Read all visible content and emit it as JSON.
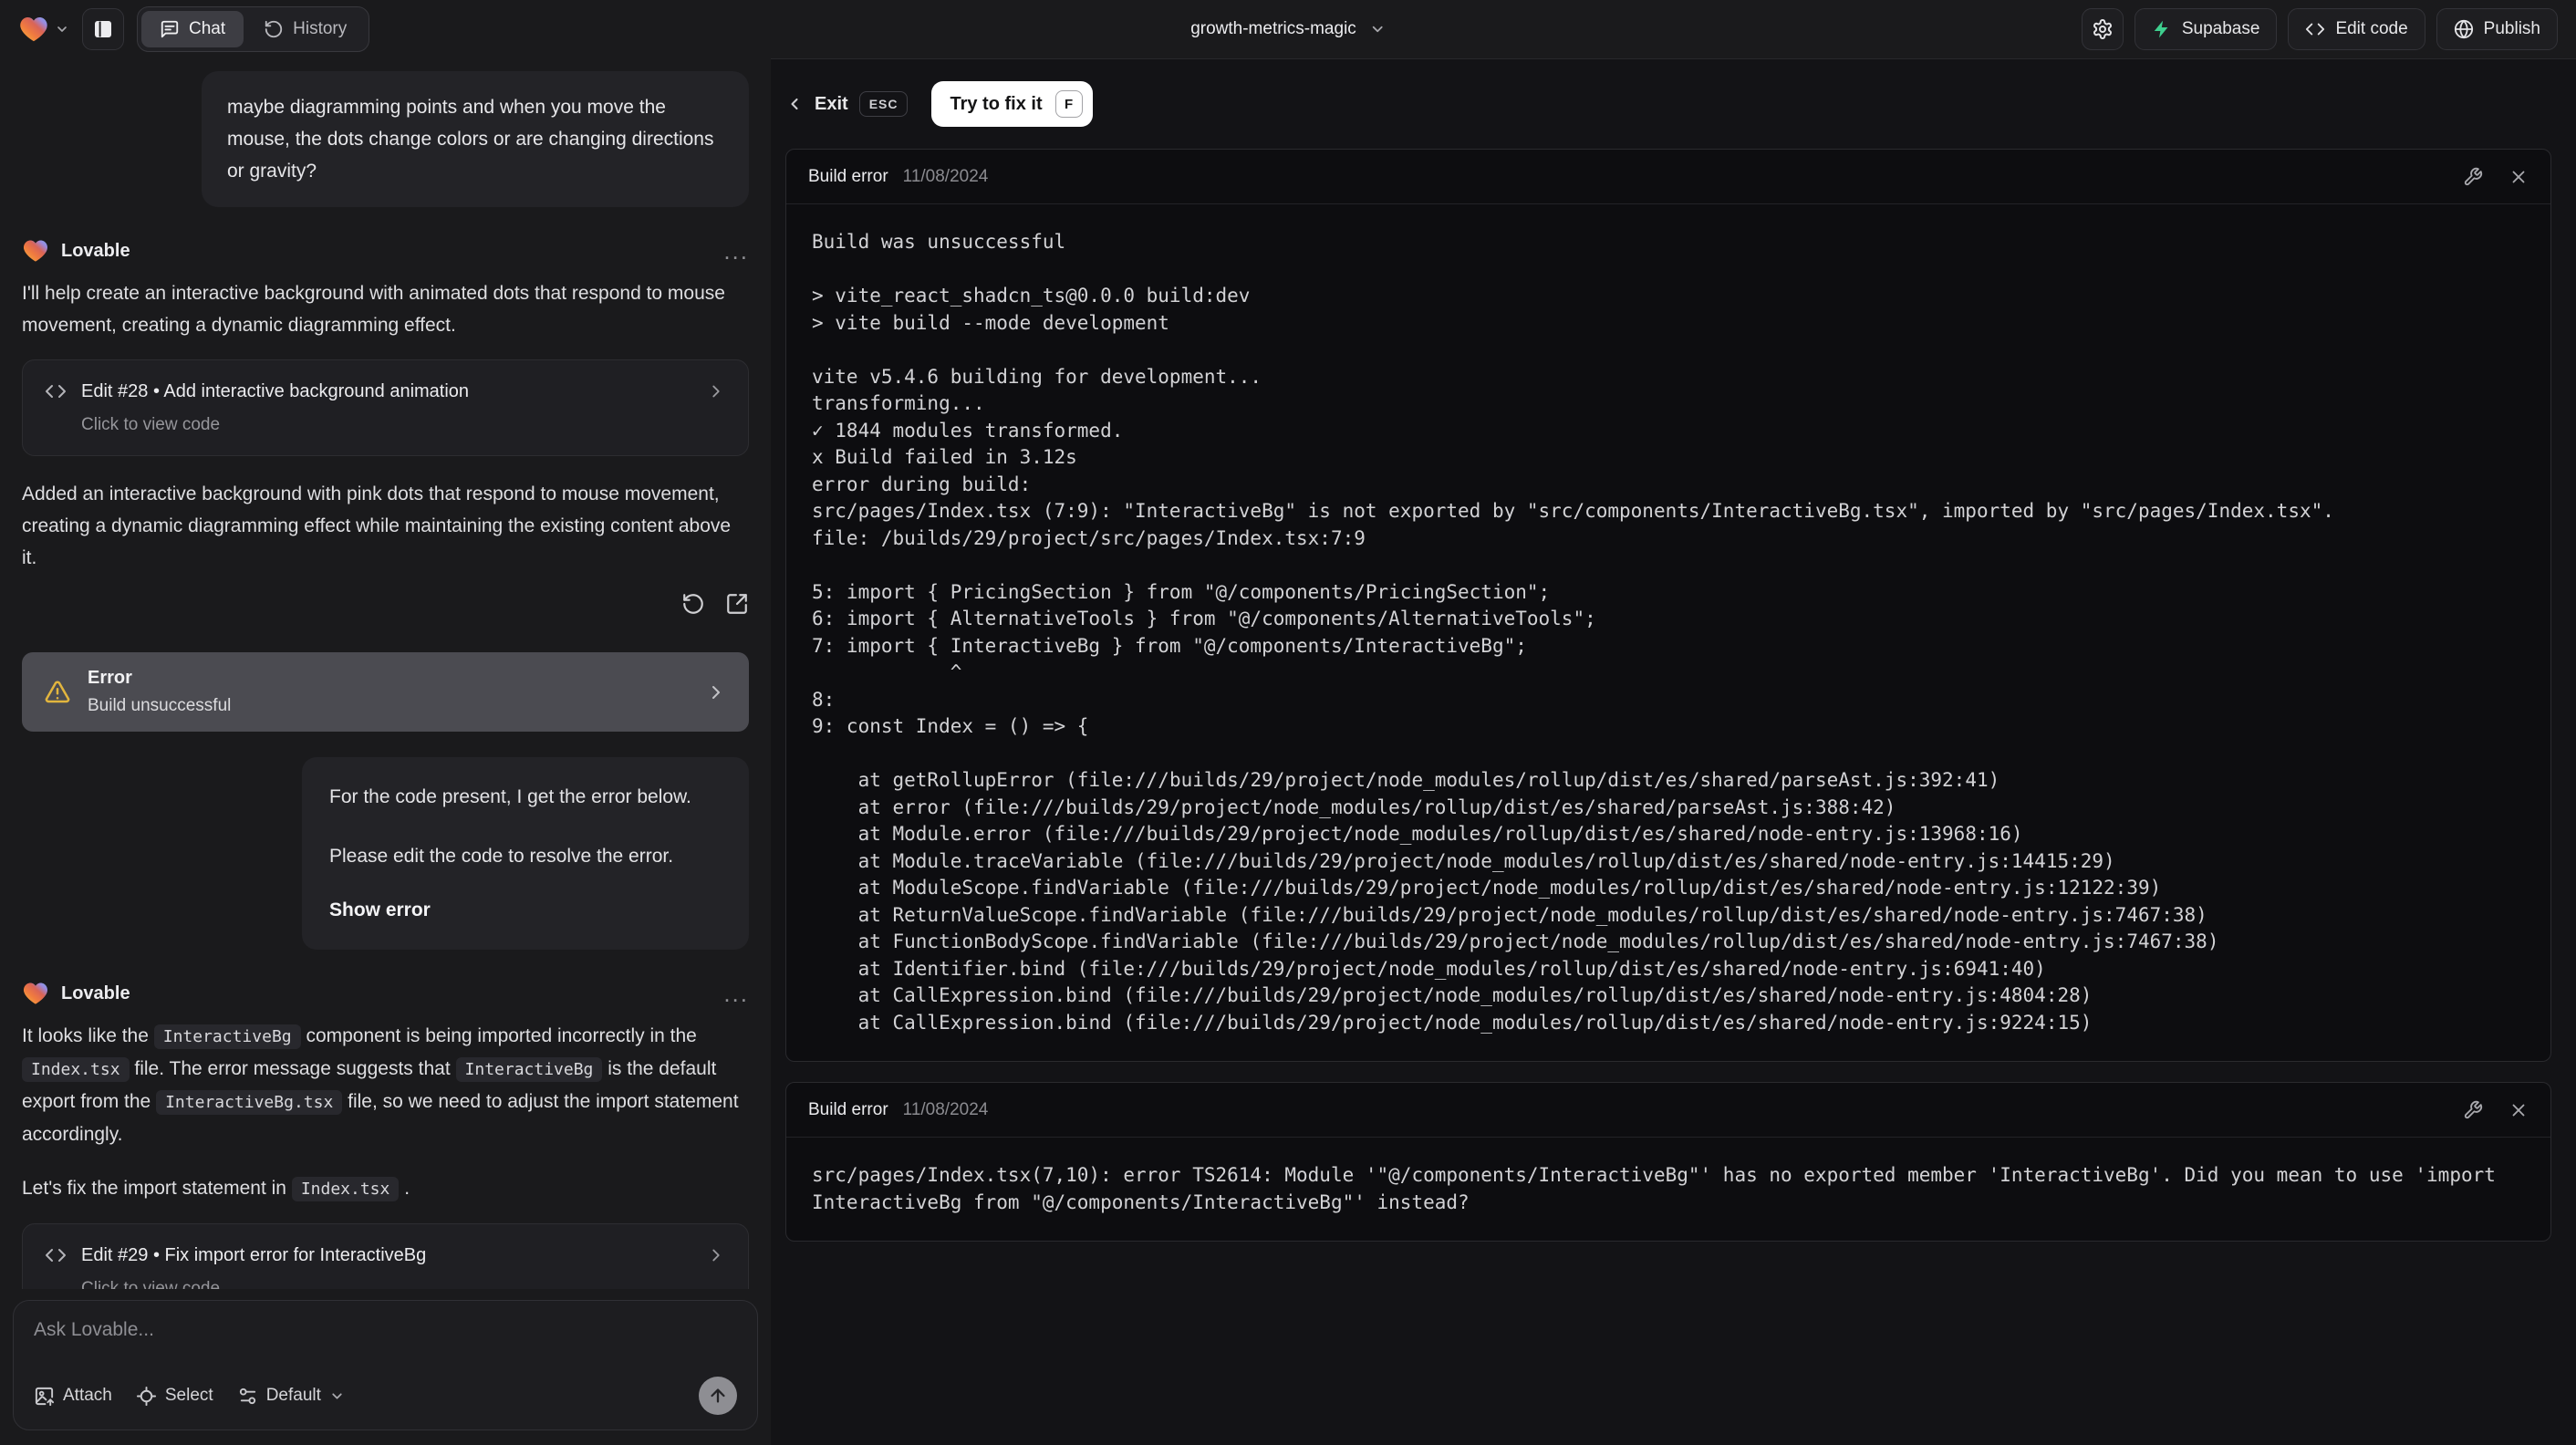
{
  "header": {
    "tabs": [
      {
        "label": "Chat"
      },
      {
        "label": "History"
      }
    ],
    "project_name": "growth-metrics-magic",
    "supabase_label": "Supabase",
    "edit_code_label": "Edit code",
    "publish_label": "Publish"
  },
  "icons": {
    "ellipsis": "..."
  },
  "chat": {
    "assistant_name": "Lovable",
    "user_message": "maybe diagramming points and when you move the mouse, the dots change colors or are changing directions or gravity?",
    "msg1": {
      "intro": "I'll help create an interactive background with animated dots that respond to mouse movement, creating a dynamic diagramming effect.",
      "edit_card": {
        "title": "Edit #28 • Add interactive background animation",
        "subtitle": "Click to view code"
      },
      "summary": "Added an interactive background with pink dots that respond to mouse movement, creating a dynamic diagramming effect while maintaining the existing content above it.",
      "error_card": {
        "title": "Error",
        "subtitle": "Build unsuccessful"
      }
    },
    "user_quote": {
      "line1": "For the code present, I get the error below.",
      "line2": "Please edit the code to resolve the error.",
      "action": "Show error"
    },
    "msg2": {
      "p1a": "It looks like the ",
      "p1c1": "InteractiveBg",
      "p1b": " component is being imported incorrectly in the ",
      "p1c2": "Index.tsx",
      "p1c": " file. The error message suggests that ",
      "p1c3": "InteractiveBg",
      "p1d": " is the default export from the ",
      "p1c4": "InteractiveBg.tsx",
      "p1e": " file, so we need to adjust the import statement accordingly.",
      "p2a": "Let's fix the import statement in ",
      "p2c1": "Index.tsx",
      "p2b": " .",
      "edit_card": {
        "title": "Edit #29 • Fix import error for InteractiveBg",
        "subtitle": "Click to view code"
      }
    },
    "composer": {
      "placeholder": "Ask Lovable...",
      "attach_label": "Attach",
      "select_label": "Select",
      "mode_label": "Default"
    }
  },
  "preview": {
    "exit_label": "Exit",
    "exit_key": "ESC",
    "fix_label": "Try to fix it",
    "fix_key": "F",
    "error1": {
      "title": "Build error",
      "date": "11/08/2024",
      "log": "Build was unsuccessful\n\n> vite_react_shadcn_ts@0.0.0 build:dev\n> vite build --mode development\n\nvite v5.4.6 building for development...\ntransforming...\n✓ 1844 modules transformed.\nx Build failed in 3.12s\nerror during build:\nsrc/pages/Index.tsx (7:9): \"InteractiveBg\" is not exported by \"src/components/InteractiveBg.tsx\", imported by \"src/pages/Index.tsx\".\nfile: /builds/29/project/src/pages/Index.tsx:7:9\n\n5: import { PricingSection } from \"@/components/PricingSection\";\n6: import { AlternativeTools } from \"@/components/AlternativeTools\";\n7: import { InteractiveBg } from \"@/components/InteractiveBg\";\n            ^\n8: \n9: const Index = () => {\n\n    at getRollupError (file:///builds/29/project/node_modules/rollup/dist/es/shared/parseAst.js:392:41)\n    at error (file:///builds/29/project/node_modules/rollup/dist/es/shared/parseAst.js:388:42)\n    at Module.error (file:///builds/29/project/node_modules/rollup/dist/es/shared/node-entry.js:13968:16)\n    at Module.traceVariable (file:///builds/29/project/node_modules/rollup/dist/es/shared/node-entry.js:14415:29)\n    at ModuleScope.findVariable (file:///builds/29/project/node_modules/rollup/dist/es/shared/node-entry.js:12122:39)\n    at ReturnValueScope.findVariable (file:///builds/29/project/node_modules/rollup/dist/es/shared/node-entry.js:7467:38)\n    at FunctionBodyScope.findVariable (file:///builds/29/project/node_modules/rollup/dist/es/shared/node-entry.js:7467:38)\n    at Identifier.bind (file:///builds/29/project/node_modules/rollup/dist/es/shared/node-entry.js:6941:40)\n    at CallExpression.bind (file:///builds/29/project/node_modules/rollup/dist/es/shared/node-entry.js:4804:28)\n    at CallExpression.bind (file:///builds/29/project/node_modules/rollup/dist/es/shared/node-entry.js:9224:15)"
    },
    "error2": {
      "title": "Build error",
      "date": "11/08/2024",
      "log": "src/pages/Index.tsx(7,10): error TS2614: Module '\"@/components/InteractiveBg\"' has no exported member 'InteractiveBg'. Did you mean to use 'import InteractiveBg from \"@/components/InteractiveBg\"' instead?"
    }
  },
  "colors": {
    "accent_amber": "#e2b53e",
    "supabase_green": "#3ecf8e",
    "panel_bg": "#131316",
    "card_bg": "#0d0d10"
  }
}
